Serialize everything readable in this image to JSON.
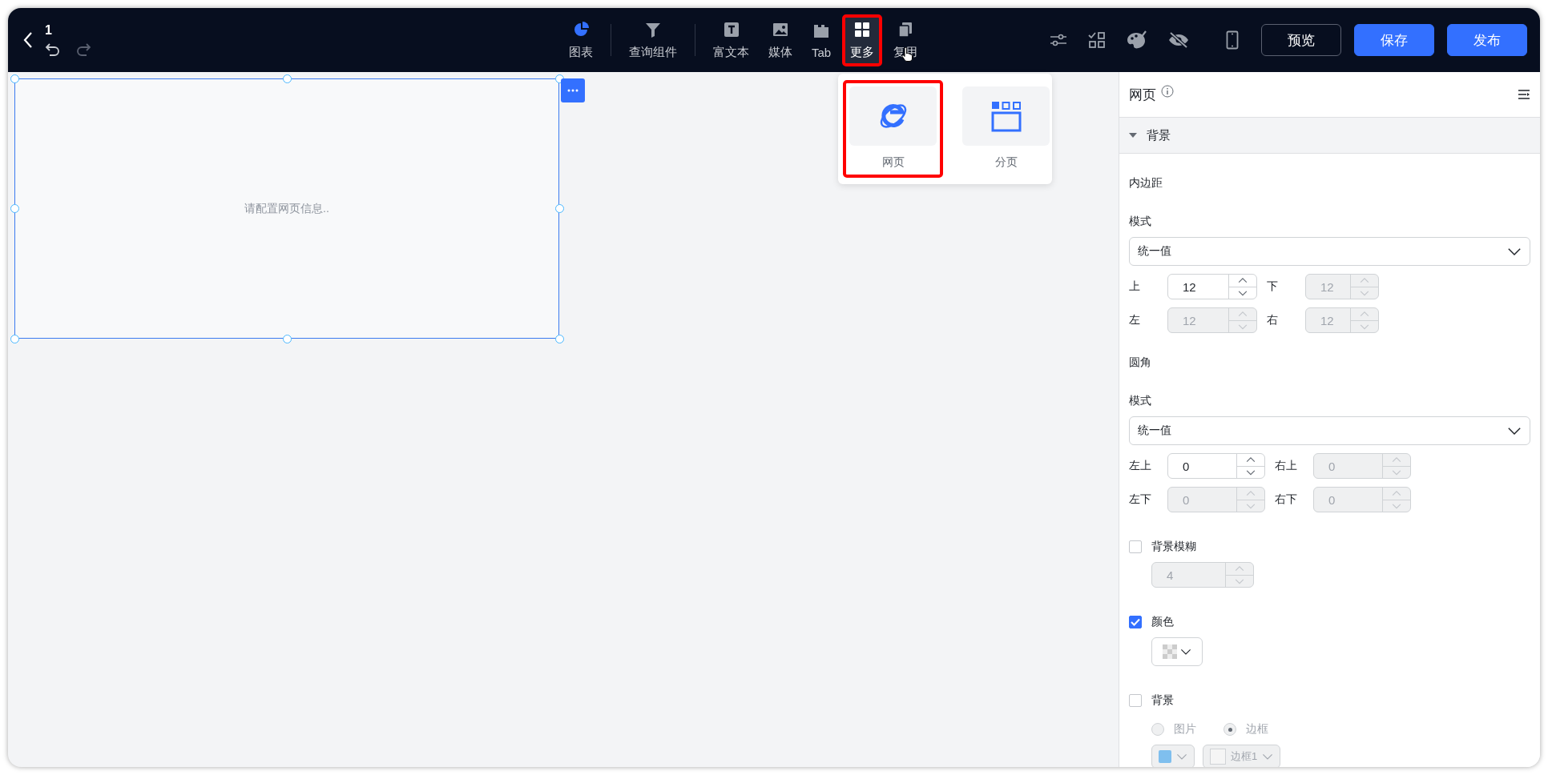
{
  "topbar": {
    "title": "1",
    "tools": [
      {
        "label": "图表",
        "selected": false,
        "highlighted": false,
        "divider_after": true
      },
      {
        "label": "查询组件",
        "selected": false,
        "highlighted": false,
        "divider_after": true
      },
      {
        "label": "富文本",
        "selected": false,
        "highlighted": false,
        "divider_after": false
      },
      {
        "label": "媒体",
        "selected": false,
        "highlighted": false,
        "divider_after": false
      },
      {
        "label": "Tab",
        "selected": false,
        "highlighted": false,
        "divider_after": false
      },
      {
        "label": "更多",
        "selected": true,
        "highlighted": true,
        "divider_after": false
      },
      {
        "label": "复用",
        "selected": false,
        "highlighted": false,
        "divider_after": false
      }
    ],
    "buttons": [
      {
        "label": "预览",
        "kind": "outline"
      },
      {
        "label": "保存",
        "kind": "primary"
      },
      {
        "label": "发布",
        "kind": "primary"
      }
    ]
  },
  "more_menu": {
    "items": [
      {
        "label": "网页",
        "highlighted": true
      },
      {
        "label": "分页",
        "highlighted": false
      }
    ]
  },
  "canvas": {
    "component_text": "请配置网页信息.."
  },
  "panel": {
    "title": "网页",
    "section": {
      "title": "背景",
      "expanded": true
    },
    "padding": {
      "label": "内边距",
      "mode_label": "模式",
      "mode": "统一值",
      "fields": [
        {
          "label": "上",
          "value": "12",
          "disabled": false
        },
        {
          "label": "下",
          "value": "12",
          "disabled": true
        },
        {
          "label": "左",
          "value": "12",
          "disabled": true
        },
        {
          "label": "右",
          "value": "12",
          "disabled": true
        }
      ]
    },
    "radius": {
      "label": "圆角",
      "mode_label": "模式",
      "mode": "统一值",
      "fields": [
        {
          "label": "左上",
          "value": "0",
          "disabled": false
        },
        {
          "label": "右上",
          "value": "0",
          "disabled": true
        },
        {
          "label": "左下",
          "value": "0",
          "disabled": true
        },
        {
          "label": "右下",
          "value": "0",
          "disabled": true
        }
      ]
    },
    "blur": {
      "label": "背景模糊",
      "checked": false,
      "value": "4"
    },
    "color": {
      "label": "颜色",
      "checked": true
    },
    "background": {
      "label": "背景",
      "checked": false,
      "options": [
        {
          "label": "图片",
          "selected": false
        },
        {
          "label": "边框",
          "selected": true
        }
      ],
      "border_select": "边框1"
    }
  }
}
